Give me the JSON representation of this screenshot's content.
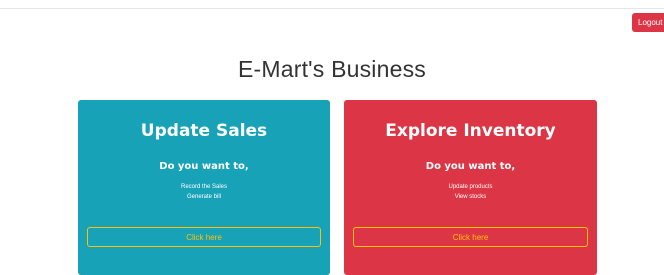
{
  "header": {
    "logout_label": "Logout"
  },
  "page_title": "E-Mart's Business",
  "cards": [
    {
      "title": "Update Sales",
      "question": "Do you want to,",
      "lines": [
        "Record the Sales",
        "Generate bill"
      ],
      "button_label": "Click here",
      "color": "#17a2b8"
    },
    {
      "title": "Explore Inventory",
      "question": "Do you want to,",
      "lines": [
        "Update products",
        "View stocks"
      ],
      "button_label": "Click here",
      "color": "#dc3545"
    }
  ],
  "colors": {
    "logout": "#dc3545",
    "button_outline": "#ffc107"
  }
}
